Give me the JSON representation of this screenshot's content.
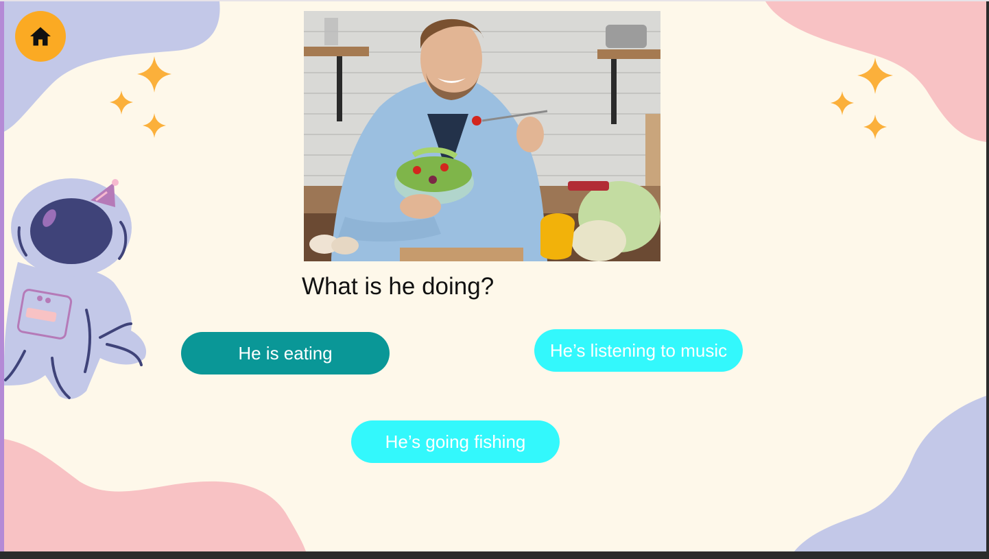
{
  "nav": {
    "home_icon": "home-icon"
  },
  "colors": {
    "background": "#fef8ea",
    "home_button": "#fbaa23",
    "selected_answer": "#0a9797",
    "answer": "#33f8fc",
    "answer_text": "#ffffff",
    "blob_blue": "#c3c8e8",
    "blob_pink": "#f8c2c4",
    "sparkle": "#fbb03b"
  },
  "question": {
    "image_subject": "man eating a salad in a kitchen",
    "text": "What is he doing?"
  },
  "answers": [
    {
      "label": "He is eating",
      "selected": true
    },
    {
      "label": "He’s listening to music",
      "selected": false
    },
    {
      "label": "He’s going fishing",
      "selected": false
    }
  ]
}
